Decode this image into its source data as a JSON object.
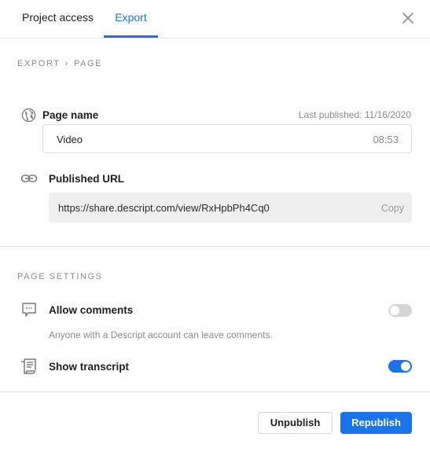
{
  "tabs": [
    {
      "label": "Project access",
      "active": false
    },
    {
      "label": "Export",
      "active": true
    }
  ],
  "breadcrumb": {
    "first": "EXPORT",
    "separator": "›",
    "second": "PAGE"
  },
  "page_name": {
    "label": "Page name",
    "last_published": "Last published: 11/16/2020",
    "value": "Video",
    "duration": "08:53",
    "icon": "globe-icon"
  },
  "published_url": {
    "label": "Published URL",
    "value": "https://share.descript.com/view/RxHpbPh4Cq0",
    "copy_label": "Copy",
    "icon": "link-icon"
  },
  "page_settings": {
    "title": "PAGE SETTINGS",
    "allow_comments": {
      "label": "Allow comments",
      "description": "Anyone with a Descript account can leave comments.",
      "enabled": false,
      "icon": "comment-icon"
    },
    "show_transcript": {
      "label": "Show transcript",
      "enabled": true,
      "icon": "transcript-icon"
    }
  },
  "footer": {
    "unpublish_label": "Unpublish",
    "republish_label": "Republish"
  },
  "colors": {
    "accent": "#1a73e8",
    "muted_text": "#8a8a8a",
    "toggle_off": "#d5d5d5"
  }
}
